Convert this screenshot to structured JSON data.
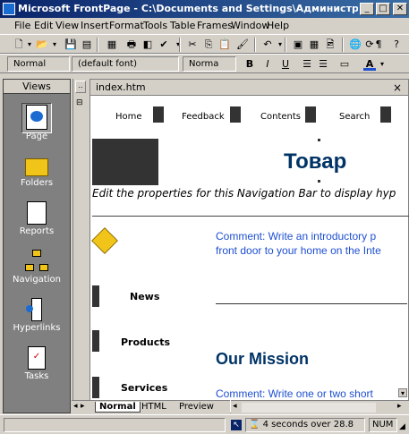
{
  "window": {
    "title": "Microsoft FrontPage - C:\\Documents and Settings\\Администратор\\Мои доку...",
    "min": "_",
    "max": "□",
    "close": "✕"
  },
  "menu": [
    "File",
    "Edit",
    "View",
    "Insert",
    "Format",
    "Tools",
    "Table",
    "Frames",
    "Window",
    "Help"
  ],
  "formatting": {
    "style": "Normal",
    "font": "(default font)",
    "size": "Norma"
  },
  "views": {
    "title": "Views",
    "items": [
      "Page",
      "Folders",
      "Reports",
      "Navigation",
      "Hyperlinks",
      "Tasks"
    ]
  },
  "editor": {
    "tab": "index.htm",
    "close": "×",
    "nav_links": [
      "Home",
      "Feedback",
      "Contents",
      "Search"
    ],
    "heading": "Товар",
    "nav_message": "Edit the properties for this Navigation Bar to display hyp",
    "comment1_line1": "Comment: Write an introductory p",
    "comment1_line2": "front door to your home on the Inte",
    "side_links": [
      "News",
      "Products",
      "Services"
    ],
    "mission_heading": "Our Mission",
    "comment2": "Comment: Write one or two short"
  },
  "view_tabs": [
    "Normal",
    "HTML",
    "Preview"
  ],
  "status": {
    "time": "4 seconds over 28.8",
    "mode": "NUM"
  },
  "colors": {
    "titlebar": "#0a246a",
    "comment": "#1e4fd0",
    "heading": "#003366"
  }
}
